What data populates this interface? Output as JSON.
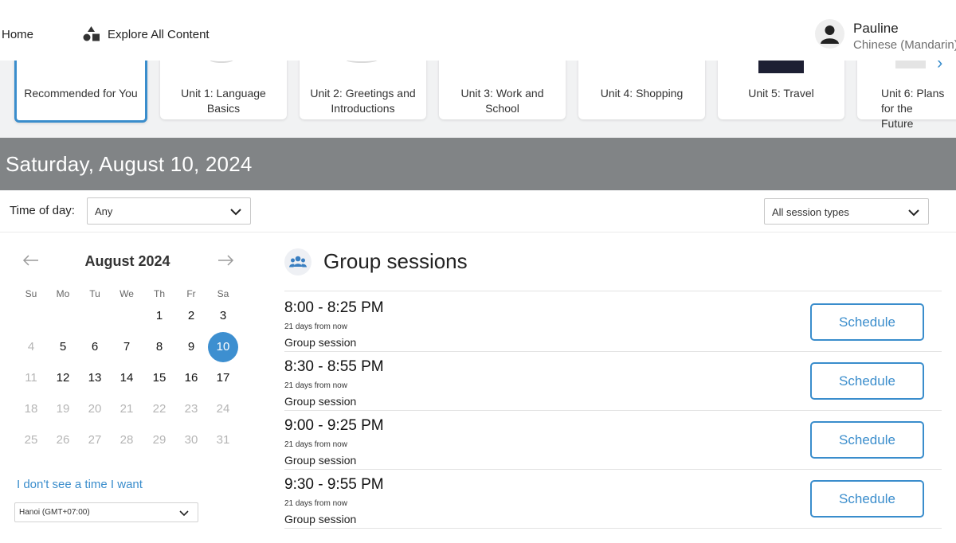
{
  "nav": {
    "home_label": "Home",
    "explore_label": "Explore All Content",
    "explore_icon": "shapes-icon",
    "user": {
      "name": "Pauline",
      "language": "Chinese (Mandarin)"
    }
  },
  "units": [
    {
      "title": "Recommended for You",
      "selected": true
    },
    {
      "title": "Unit 1: Language Basics"
    },
    {
      "title": "Unit 2: Greetings and Introductions"
    },
    {
      "title": "Unit 3: Work and School"
    },
    {
      "title": "Unit 4: Shopping"
    },
    {
      "title": "Unit 5: Travel"
    },
    {
      "title": "Unit 6: Plans for the Future"
    }
  ],
  "date_banner": "Saturday, August 10, 2024",
  "filters": {
    "time_of_day_label": "Time of day:",
    "time_of_day_value": "Any",
    "session_type_value": "All session types"
  },
  "calendar": {
    "month_label": "August 2024",
    "weekdays": [
      "Su",
      "Mo",
      "Tu",
      "We",
      "Th",
      "Fr",
      "Sa"
    ],
    "weeks": [
      [
        null,
        null,
        null,
        null,
        1,
        2,
        3
      ],
      [
        4,
        5,
        6,
        7,
        8,
        9,
        10
      ],
      [
        11,
        12,
        13,
        14,
        15,
        16,
        17
      ],
      [
        18,
        19,
        20,
        21,
        22,
        23,
        24
      ],
      [
        25,
        26,
        27,
        28,
        29,
        30,
        31
      ]
    ],
    "available_days": [
      1,
      2,
      3,
      5,
      6,
      7,
      8,
      9,
      10,
      12,
      13,
      14,
      15,
      16,
      17
    ],
    "selected_day": 10,
    "cant_find_link": "I don't see a time I want",
    "timezone": "Hanoi (GMT+07:00)"
  },
  "sessions": {
    "heading": "Group sessions",
    "items": [
      {
        "time": "8:00 - 8:25 PM",
        "relative": "21 days from now",
        "type": "Group session",
        "button": "Schedule"
      },
      {
        "time": "8:30 - 8:55 PM",
        "relative": "21 days from now",
        "type": "Group session",
        "button": "Schedule"
      },
      {
        "time": "9:00 - 9:25 PM",
        "relative": "21 days from now",
        "type": "Group session",
        "button": "Schedule"
      },
      {
        "time": "9:30 - 9:55 PM",
        "relative": "21 days from now",
        "type": "Group session",
        "button": "Schedule"
      }
    ]
  },
  "colors": {
    "accent": "#3a8dcc",
    "banner_bg": "#818486",
    "selected_day_bg": "#3d8fd0"
  }
}
